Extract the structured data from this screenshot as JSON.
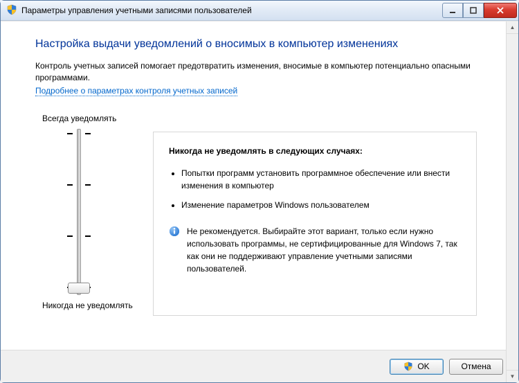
{
  "window": {
    "title": "Параметры управления учетными записями пользователей"
  },
  "heading": "Настройка выдачи уведомлений о вносимых в компьютер изменениях",
  "intro": "Контроль учетных записей помогает предотвратить изменения, вносимые в компьютер потенциально опасными программами.",
  "help_link": "Подробнее о параметрах контроля учетных записей",
  "slider": {
    "label_top": "Всегда уведомлять",
    "label_bot": "Никогда не уведомлять",
    "levels": 4,
    "current_level": 0
  },
  "description": {
    "heading": "Никогда не уведомлять в следующих случаях:",
    "bullets": [
      "Попытки программ установить программное обеспечение или внести изменения в компьютер",
      "Изменение параметров Windows пользователем"
    ],
    "recommendation": "Не рекомендуется. Выбирайте этот вариант, только если нужно использовать программы, не сертифицированные для Windows 7, так как они не поддерживают управление учетными записями пользователей."
  },
  "buttons": {
    "ok": "OK",
    "cancel": "Отмена"
  }
}
